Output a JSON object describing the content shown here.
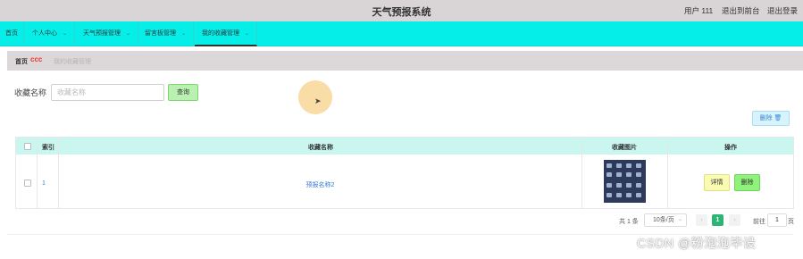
{
  "header": {
    "title": "天气预报系统",
    "user": "用户 111",
    "back_to_admin": "退出到前台",
    "logout": "退出登录"
  },
  "nav": {
    "items": [
      {
        "label": "首页"
      },
      {
        "label": "个人中心"
      },
      {
        "label": "天气预报管理"
      },
      {
        "label": "留言板管理"
      },
      {
        "label": "我的收藏管理"
      }
    ]
  },
  "breadcrumb": {
    "home": "首页",
    "separator": "ccc",
    "current": "我的收藏管理"
  },
  "search": {
    "label": "收藏名称",
    "placeholder": "收藏名称",
    "button": "查询"
  },
  "toolbar": {
    "delete_label": "删除 🗑"
  },
  "table": {
    "headers": [
      "索引",
      "收藏名称",
      "收藏图片",
      "操作"
    ],
    "rows": [
      {
        "index": "1",
        "name": "预报名称2",
        "detail": "详情",
        "delete": "删除"
      }
    ]
  },
  "pagination": {
    "total": "共 1 条",
    "page_size": "10条/页",
    "current_page": "1",
    "goto_label": "前往",
    "goto_value": "1",
    "page_suffix": "页"
  },
  "watermark": "CSDN @粉泡泡毕设",
  "colors": {
    "topbar": "#d9d4d5",
    "navbar": "#06eee8",
    "table_header": "#c9f7ef",
    "accent_green": "#2bb673"
  }
}
